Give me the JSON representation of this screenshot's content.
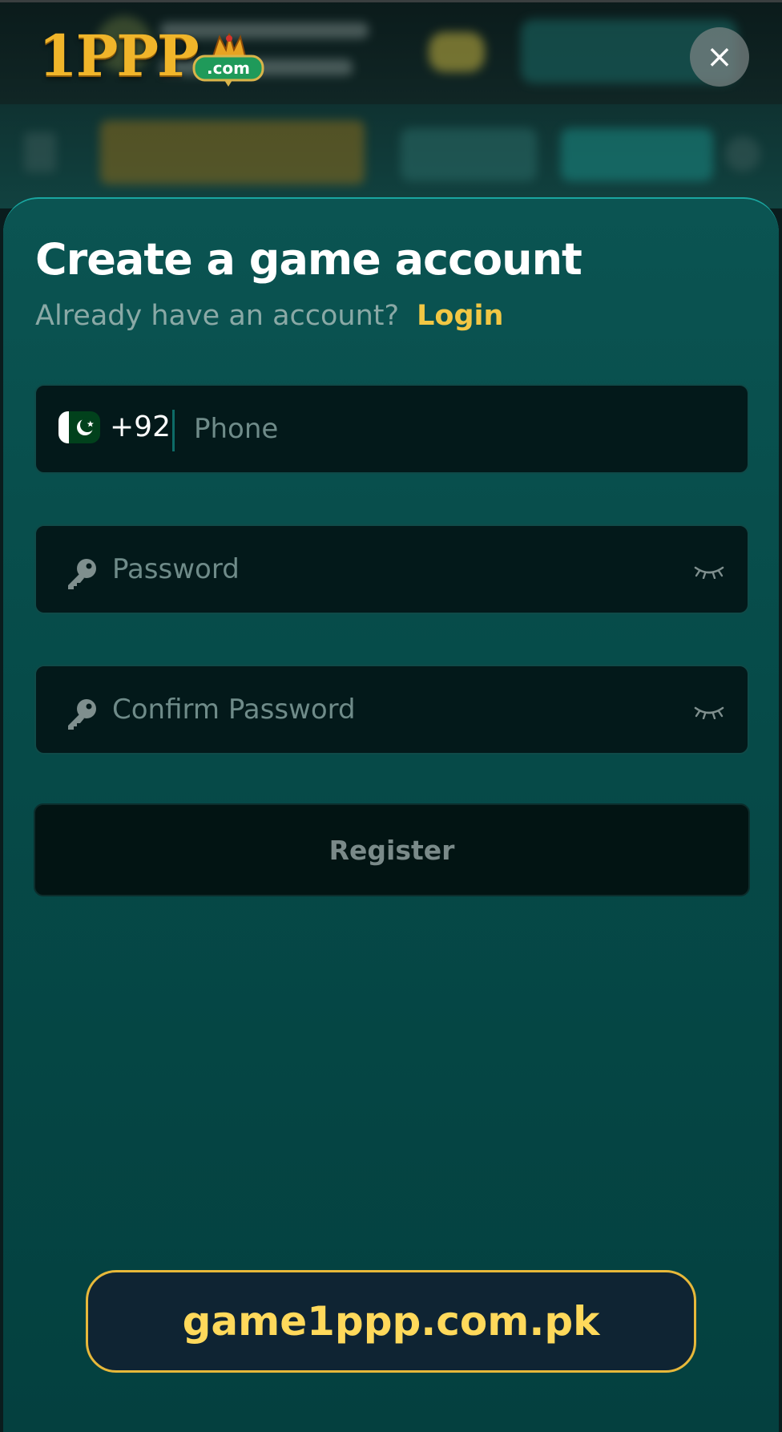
{
  "brand": {
    "logo_text": "1PPP",
    "logo_badge": ".com"
  },
  "close": {
    "label": "×"
  },
  "modal": {
    "title": "Create a game account",
    "subtitle": "Already have an account?",
    "login_link": "Login"
  },
  "phone": {
    "country_flag": "pakistan-flag-icon",
    "dial_code": "+92",
    "placeholder": "Phone",
    "value": ""
  },
  "password": {
    "icon": "key-icon",
    "placeholder": "Password",
    "value": "",
    "toggle_icon": "eye-closed-icon"
  },
  "confirm_password": {
    "icon": "key-icon",
    "placeholder": "Confirm Password",
    "value": "",
    "toggle_icon": "eye-closed-icon"
  },
  "register": {
    "label": "Register"
  },
  "watermark": {
    "text": "game1ppp.com.pk"
  },
  "colors": {
    "accent_gold": "#f2c744",
    "sheet_bg": "#064b49",
    "field_bg": "#03191a"
  }
}
